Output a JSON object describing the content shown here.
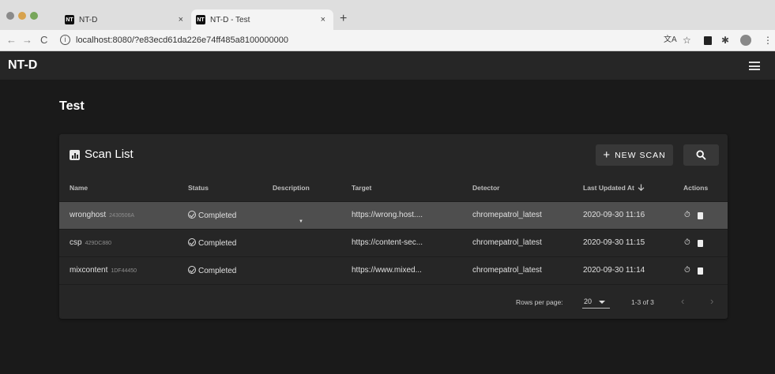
{
  "browser": {
    "tabs": [
      {
        "title": "NT-D",
        "favicon": "NT"
      },
      {
        "title": "NT-D - Test",
        "favicon": "NT"
      }
    ],
    "close_glyph": "×",
    "new_tab_glyph": "+",
    "url": "localhost:8080/?e83ecd61da226e74ff485a8100000000"
  },
  "app": {
    "brand": "NT-D",
    "page_title": "Test"
  },
  "card": {
    "title": "Scan List",
    "new_scan_label": "NEW SCAN",
    "columns": [
      "Name",
      "Status",
      "Description",
      "Target",
      "Detector",
      "Last Updated At",
      "Actions"
    ],
    "rows": [
      {
        "name": "wronghost",
        "id": "2430506A",
        "status": "Completed",
        "description": "",
        "target": "https://wrong.host....",
        "detector": "chromepatrol_latest",
        "updated": "2020-09-30 11:16"
      },
      {
        "name": "csp",
        "id": "429DC880",
        "status": "Completed",
        "description": "",
        "target": "https://content-sec...",
        "detector": "chromepatrol_latest",
        "updated": "2020-09-30 11:15"
      },
      {
        "name": "mixcontent",
        "id": "1DF44450",
        "status": "Completed",
        "description": "",
        "target": "https://www.mixed...",
        "detector": "chromepatrol_latest",
        "updated": "2020-09-30 11:14"
      }
    ],
    "footer": {
      "rows_per_page_label": "Rows per page:",
      "rows_per_page_value": "20",
      "range": "1-3 of 3"
    }
  }
}
